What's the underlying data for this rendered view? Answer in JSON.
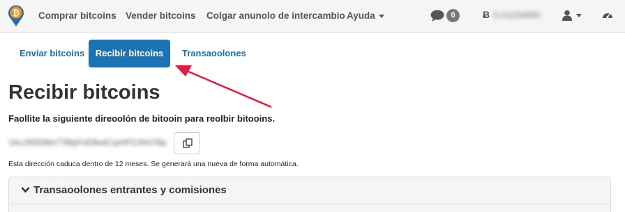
{
  "navbar": {
    "brand_logo": "bitcoin-pin-logo",
    "links": [
      {
        "label": "Comprar bitcoins"
      },
      {
        "label": "Vender bitcoins"
      },
      {
        "label": "Colgar anunolo de intercambio"
      },
      {
        "label": "Ayuda"
      }
    ],
    "messages_count": "0",
    "btc_symbol": "Ƀ",
    "balance": "0.01154890",
    "icons": [
      "chat-icon",
      "bitcoin-icon",
      "user-icon",
      "dashboard-gauge-icon"
    ]
  },
  "tabs": [
    {
      "label": "Enviar bitcoins",
      "active": false
    },
    {
      "label": "Recibir bitcoins",
      "active": true
    },
    {
      "label": "Transaoolones",
      "active": false
    }
  ],
  "main": {
    "title": "Recibir bitcoins",
    "instruction": "Faollite la siguiente direoolón de bitooin para reolbir bitooins.",
    "address": "1AoJN5DMx77BfpFxEBwtCrpHPZJhhi7Bp",
    "expiry_note": "Esta dirección caduca dentro de 12 meses. Se generará una nueva de forma automática.",
    "panel_title": "Transaoolones entrantes y comisiones"
  },
  "colors": {
    "accent": "#1a73b5",
    "link": "#1a6fa8",
    "annotation_arrow": "#e8173c",
    "logo_orange": "#f7931a",
    "logo_blue": "#1f6fb2"
  }
}
